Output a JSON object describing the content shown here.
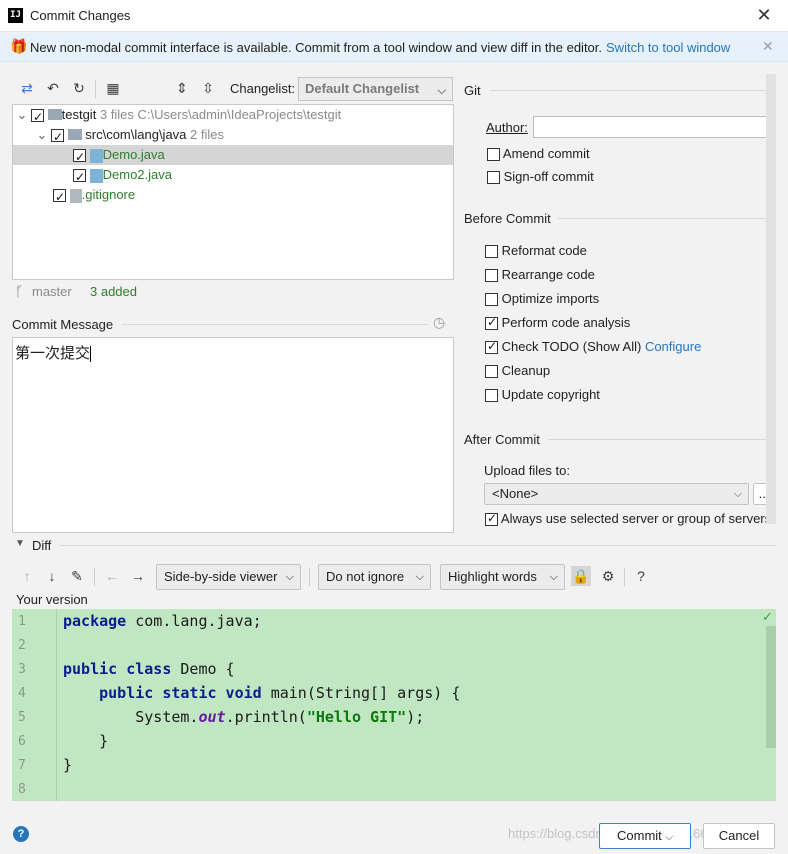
{
  "window": {
    "title": "Commit Changes",
    "app_icon": "IJ"
  },
  "banner": {
    "text": "New non-modal commit interface is available. Commit from a tool window and view diff in the editor.",
    "link": "Switch to tool window"
  },
  "toolbar": {
    "changelist_label": "Changelist:",
    "changelist_value": "Default Changelist"
  },
  "tree": {
    "root": {
      "name": "testgit",
      "count": "3 files",
      "path": "C:\\Users\\admin\\IdeaProjects\\testgit"
    },
    "folder": {
      "name": "src\\com\\lang\\java",
      "count": "2 files"
    },
    "files": [
      {
        "name": "Demo.java"
      },
      {
        "name": "Demo2.java"
      },
      {
        "name": ".gitignore"
      }
    ]
  },
  "status": {
    "branch": "master",
    "added": "3 added"
  },
  "commit_message": {
    "label": "Commit Message",
    "value": "第一次提交"
  },
  "git": {
    "section": "Git",
    "author_label": "Author:",
    "author_value": "",
    "amend": "Amend commit",
    "signoff": "Sign-off commit"
  },
  "before_commit": {
    "section": "Before Commit",
    "reformat": "Reformat code",
    "rearrange": "Rearrange code",
    "optimize": "Optimize imports",
    "analysis": "Perform code analysis",
    "todo": "Check TODO (Show All)",
    "configure": "Configure",
    "cleanup": "Cleanup",
    "copyright": "Update copyright"
  },
  "after_commit": {
    "section": "After Commit",
    "upload_label": "Upload files to:",
    "upload_value": "<None>",
    "more": "...",
    "always": "Always use selected server or group of servers"
  },
  "diff": {
    "section": "Diff",
    "viewer": "Side-by-side viewer",
    "ignore": "Do not ignore",
    "highlight": "Highlight words",
    "help": "?",
    "version_label": "Your version",
    "line_numbers": [
      "1",
      "2",
      "3",
      "4",
      "5",
      "6",
      "7",
      "8"
    ],
    "code": {
      "l1_kw": "package",
      "l1_rest": " com.lang.java;",
      "l3_kw": "public class",
      "l3_rest": " Demo {",
      "l4_indent": "    ",
      "l4_kw": "public static void",
      "l4_rest": " main(String[] args) {",
      "l5_a": "        System.",
      "l5_field": "out",
      "l5_b": ".println(",
      "l5_str": "\"Hello GIT\"",
      "l5_c": ");",
      "l6": "    }",
      "l7": "}"
    }
  },
  "footer": {
    "commit": "Commit",
    "cancel": "Cancel",
    "help": "?",
    "watermark": "https://blog.csdn.net/weixin_4....66"
  }
}
